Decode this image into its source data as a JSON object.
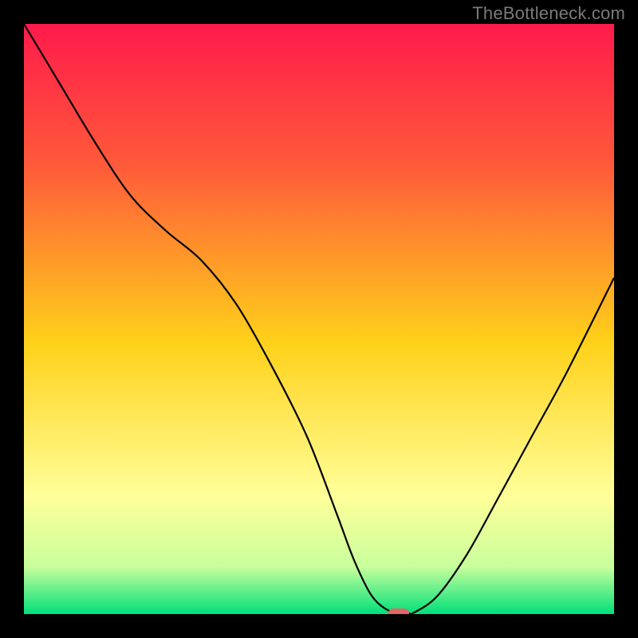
{
  "watermark": "TheBottleneck.com",
  "colors": {
    "gradient_top": "#ff1a4b",
    "gradient_mid_top": "#ff5a3a",
    "gradient_mid": "#ffd11a",
    "gradient_lower": "#ffff99",
    "gradient_near_bottom": "#c8ff9c",
    "gradient_bottom": "#00e07a",
    "curve": "#000000",
    "marker": "#e06666",
    "background": "#000000"
  },
  "chart_data": {
    "type": "line",
    "title": "",
    "xlabel": "",
    "ylabel": "",
    "xlim": [
      0,
      100
    ],
    "ylim": [
      0,
      100
    ],
    "series": [
      {
        "name": "bottleneck-curve",
        "x": [
          0,
          6,
          12,
          18,
          24,
          30,
          36,
          42,
          48,
          53,
          56,
          59,
          62,
          65,
          66,
          70,
          75,
          80,
          86,
          92,
          100
        ],
        "y": [
          100,
          90,
          80,
          71,
          65,
          60,
          52.5,
          42,
          30,
          17,
          9,
          3,
          0.5,
          0.2,
          0.2,
          3,
          10,
          19,
          30,
          41,
          57
        ]
      }
    ],
    "annotations": [
      {
        "name": "optimal-marker",
        "x": 63.5,
        "y": 0,
        "shape": "pill",
        "color": "#e06666"
      }
    ],
    "gradient_stops": [
      {
        "offset": 0.0,
        "color": "#ff1a4b"
      },
      {
        "offset": 0.24,
        "color": "#ff5a3a"
      },
      {
        "offset": 0.54,
        "color": "#ffd11a"
      },
      {
        "offset": 0.8,
        "color": "#ffff99"
      },
      {
        "offset": 0.92,
        "color": "#c8ff9c"
      },
      {
        "offset": 1.0,
        "color": "#00e07a"
      }
    ]
  }
}
